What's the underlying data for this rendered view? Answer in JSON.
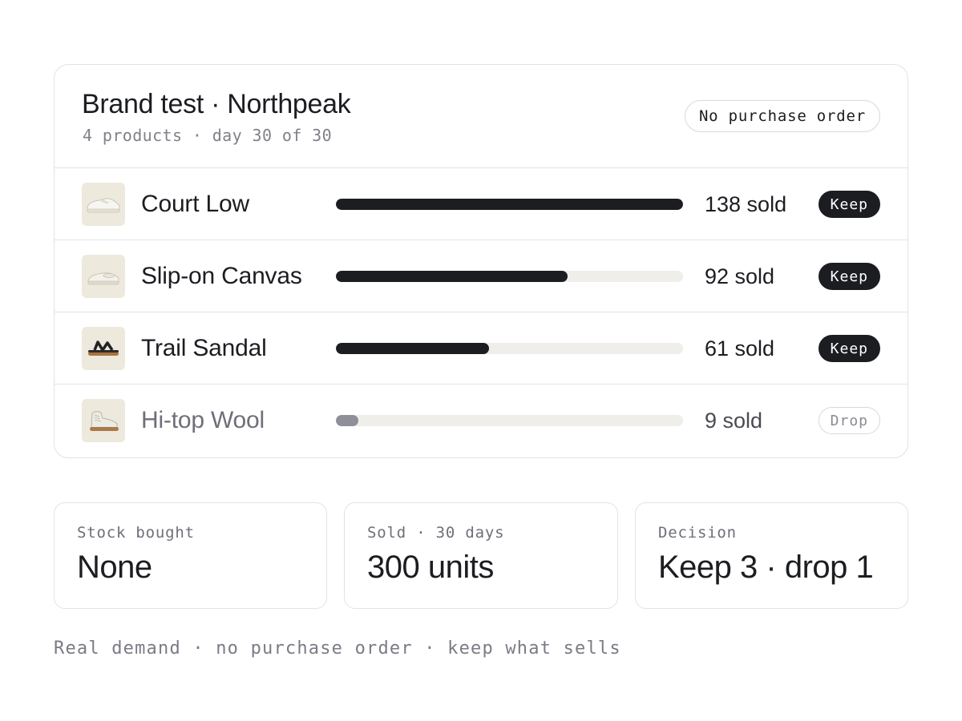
{
  "header": {
    "title": "Brand test · Northpeak",
    "subtitle": "4 products · day 30 of 30",
    "badge": "No purchase order"
  },
  "products": [
    {
      "name": "Court Low",
      "sold_label": "138 sold",
      "units": 138,
      "bar_fraction": 1.0,
      "decision": "Keep",
      "icon": "sneaker-low-icon"
    },
    {
      "name": "Slip-on Canvas",
      "sold_label": "92 sold",
      "units": 92,
      "bar_fraction": 0.667,
      "decision": "Keep",
      "icon": "slip-on-shoe-icon"
    },
    {
      "name": "Trail Sandal",
      "sold_label": "61 sold",
      "units": 61,
      "bar_fraction": 0.442,
      "decision": "Keep",
      "icon": "sandal-icon"
    },
    {
      "name": "Hi-top Wool",
      "sold_label": "9 sold",
      "units": 9,
      "bar_fraction": 0.065,
      "decision": "Drop",
      "icon": "hi-top-shoe-icon"
    }
  ],
  "stats": [
    {
      "label": "Stock bought",
      "value": "None"
    },
    {
      "label": "Sold · 30 days",
      "value": "300 units"
    },
    {
      "label": "Decision",
      "value": "Keep 3 · drop 1"
    }
  ],
  "footer": "Real demand · no purchase order · keep what sells",
  "colors": {
    "text": "#1c1d21",
    "muted": "#80808a",
    "bar_fill": "#1c1d21",
    "bar_fill_dropped": "#8e8f99",
    "bar_track": "#efeeea",
    "thumb_bg": "#ede9dd",
    "border": "#e3e3e6"
  }
}
